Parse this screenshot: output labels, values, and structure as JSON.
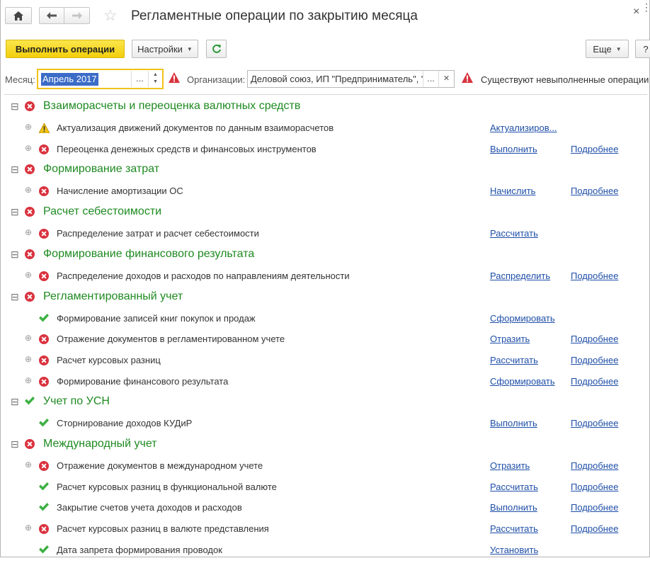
{
  "window": {
    "title": "Регламентные операции по закрытию месяца",
    "close_glyph": "×",
    "restore_glyph": "⋮"
  },
  "toolbar": {
    "execute_label": "Выполнить операции",
    "settings_label": "Настройки",
    "refresh_icon": "refresh-icon",
    "more_label": "Еще",
    "help_label": "?"
  },
  "filters": {
    "month_label": "Месяц:",
    "month_value": "Апрель 2017",
    "org_label": "Организации:",
    "org_value": "Деловой союз, ИП \"Предприниматель\", \"",
    "notice": "Существуют невыполненные операции"
  },
  "colors": {
    "group_text": "#1e8a21",
    "link": "#1f4fa8",
    "error": "#d9333f",
    "ok": "#3cb043",
    "warning": "#f0c419",
    "primary_button": "#f2cf0b"
  },
  "tree": [
    {
      "kind": "group",
      "status": "error",
      "label": "Взаиморасчеты и переоценка валютных средств"
    },
    {
      "kind": "item",
      "status": "warning",
      "expand": true,
      "label": "Актуализация движений документов по данным взаиморасчетов",
      "action": "Актуализиров...",
      "details": ""
    },
    {
      "kind": "item",
      "status": "error",
      "expand": true,
      "label": "Переоценка денежных средств и финансовых инструментов",
      "action": "Выполнить",
      "details": "Подробнее"
    },
    {
      "kind": "group",
      "status": "error",
      "label": "Формирование затрат"
    },
    {
      "kind": "item",
      "status": "error",
      "expand": true,
      "label": "Начисление амортизации ОС",
      "action": "Начислить",
      "details": "Подробнее"
    },
    {
      "kind": "group",
      "status": "error",
      "label": "Расчет себестоимости"
    },
    {
      "kind": "item",
      "status": "error",
      "expand": true,
      "label": "Распределение затрат и расчет себестоимости",
      "action": "Рассчитать",
      "details": ""
    },
    {
      "kind": "group",
      "status": "error",
      "label": "Формирование финансового результата"
    },
    {
      "kind": "item",
      "status": "error",
      "expand": true,
      "label": "Распределение доходов и расходов по направлениям деятельности",
      "action": "Распределить",
      "details": "Подробнее"
    },
    {
      "kind": "group",
      "status": "error",
      "label": "Регламентированный учет"
    },
    {
      "kind": "item",
      "status": "ok",
      "expand": false,
      "label": "Формирование записей книг покупок и продаж",
      "action": "Сформировать",
      "details": ""
    },
    {
      "kind": "item",
      "status": "error",
      "expand": true,
      "label": "Отражение документов в регламентированном учете",
      "action": "Отразить",
      "details": "Подробнее"
    },
    {
      "kind": "item",
      "status": "error",
      "expand": true,
      "label": "Расчет курсовых разниц",
      "action": "Рассчитать",
      "details": "Подробнее"
    },
    {
      "kind": "item",
      "status": "error",
      "expand": true,
      "label": "Формирование финансового результата",
      "action": "Сформировать",
      "details": "Подробнее"
    },
    {
      "kind": "group",
      "status": "ok",
      "label": "Учет по УСН"
    },
    {
      "kind": "item",
      "status": "ok",
      "expand": false,
      "label": "Сторнирование доходов КУДиР",
      "action": "Выполнить",
      "details": "Подробнее"
    },
    {
      "kind": "group",
      "status": "error",
      "label": "Международный учет"
    },
    {
      "kind": "item",
      "status": "error",
      "expand": true,
      "label": "Отражение документов в международном учете",
      "action": "Отразить",
      "details": "Подробнее"
    },
    {
      "kind": "item",
      "status": "ok",
      "expand": false,
      "label": "Расчет курсовых разниц в функциональной валюте",
      "action": "Рассчитать",
      "details": "Подробнее"
    },
    {
      "kind": "item",
      "status": "ok",
      "expand": false,
      "label": "Закрытие счетов учета доходов и расходов",
      "action": "Выполнить",
      "details": "Подробнее"
    },
    {
      "kind": "item",
      "status": "error",
      "expand": true,
      "label": "Расчет курсовых разниц в валюте представления",
      "action": "Рассчитать",
      "details": "Подробнее"
    },
    {
      "kind": "item",
      "status": "ok",
      "expand": false,
      "label": "Дата запрета формирования проводок",
      "action": "Установить",
      "details": ""
    }
  ]
}
